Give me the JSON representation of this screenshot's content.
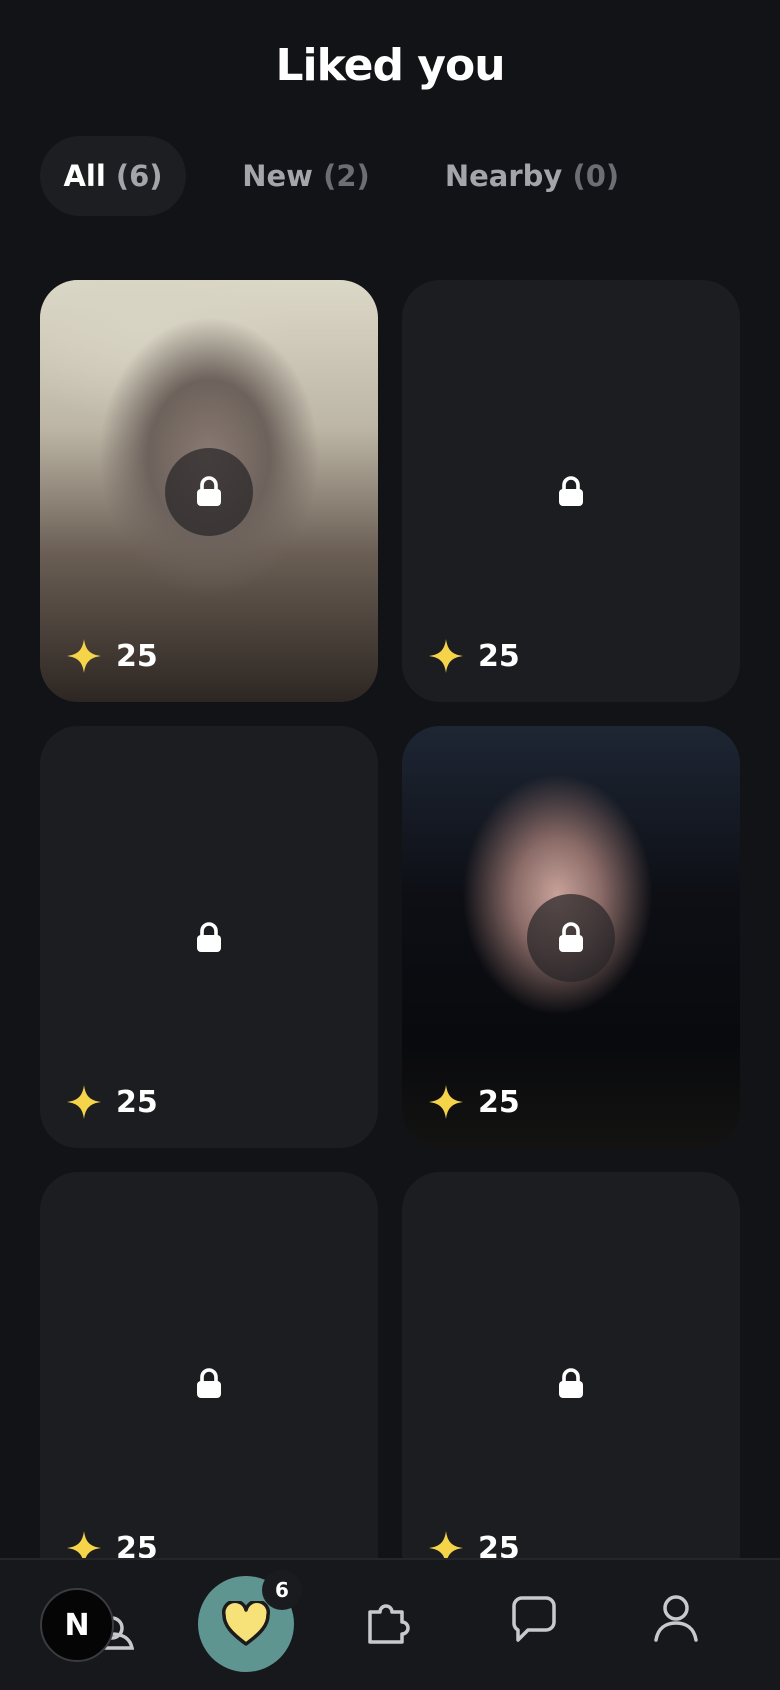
{
  "header": {
    "title": "Liked you"
  },
  "tabs": [
    {
      "label": "All",
      "count": "(6)",
      "active": true
    },
    {
      "label": "New",
      "count": "(2)",
      "active": false
    },
    {
      "label": "Nearby",
      "count": "(0)",
      "active": false
    }
  ],
  "cards": [
    {
      "score": "25",
      "photo": "blurred-photo",
      "icon": "lock-icon"
    },
    {
      "score": "25",
      "photo": "none",
      "icon": "lock-icon"
    },
    {
      "score": "25",
      "photo": "none",
      "icon": "lock-icon"
    },
    {
      "score": "25",
      "photo": "blurred-photo",
      "icon": "lock-icon"
    },
    {
      "score": "25",
      "photo": "none",
      "icon": "lock-icon"
    },
    {
      "score": "25",
      "photo": "none",
      "icon": "lock-icon"
    }
  ],
  "bottom_nav": {
    "home_avatar_letter": "N",
    "likes_badge": "6",
    "items": [
      "home",
      "likes",
      "puzzle",
      "chat",
      "profile"
    ]
  },
  "colors": {
    "background": "#121316",
    "card": "#1c1d20",
    "accent_teal": "#5f9591",
    "star_yellow": "#f5d44a",
    "heart_yellow": "#f7e27a"
  }
}
